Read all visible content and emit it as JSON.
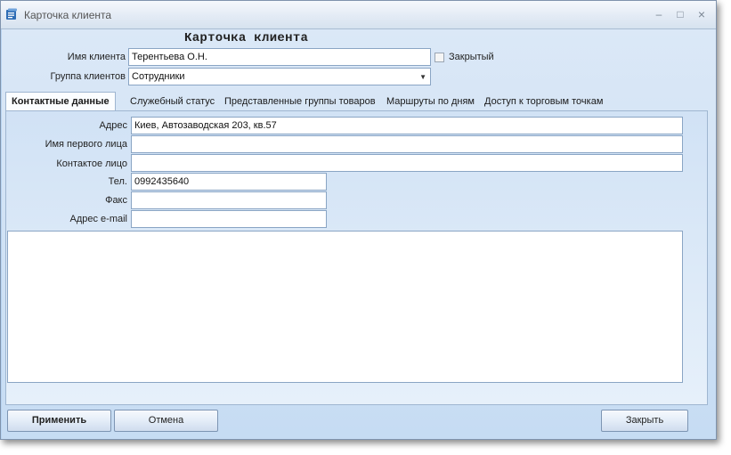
{
  "window": {
    "title": "Карточка клиента",
    "minimize": "–",
    "maximize": "□",
    "close": "×"
  },
  "heading": "Карточка клиента",
  "header_fields": {
    "client_name_label": "Имя клиента",
    "client_name_value": "Терентьева О.Н.",
    "client_group_label": "Группа клиентов",
    "client_group_value": "Сотрудники",
    "closed_label": "Закрытый",
    "closed_checked": false
  },
  "tabs": [
    {
      "label": "Контактные данные",
      "active": true
    },
    {
      "label": "Служебный статус",
      "active": false
    },
    {
      "label": "Представленные группы товаров",
      "active": false
    },
    {
      "label": "Маршруты по дням",
      "active": false
    },
    {
      "label": "Доступ к торговым точкам",
      "active": false
    }
  ],
  "contact": {
    "address_label": "Адрес",
    "address_value": "Киев, Автозаводская 203, кв.57",
    "first_person_label": "Имя первого лица",
    "first_person_value": "",
    "contact_person_label": "Контактое лицо",
    "contact_person_value": "",
    "phone_label": "Тел.",
    "phone_value": "0992435640",
    "fax_label": "Факс",
    "fax_value": "",
    "email_label": "Адрес e-mail",
    "email_value": "",
    "notes_value": ""
  },
  "buttons": {
    "apply": "Применить",
    "cancel": "Отмена",
    "close": "Закрыть"
  },
  "colors": {
    "window_bg": "#b7d3f1",
    "panel_bg": "#dbe8f7",
    "field_border": "#8aa5c4",
    "icon_blue": "#2f6db5"
  }
}
